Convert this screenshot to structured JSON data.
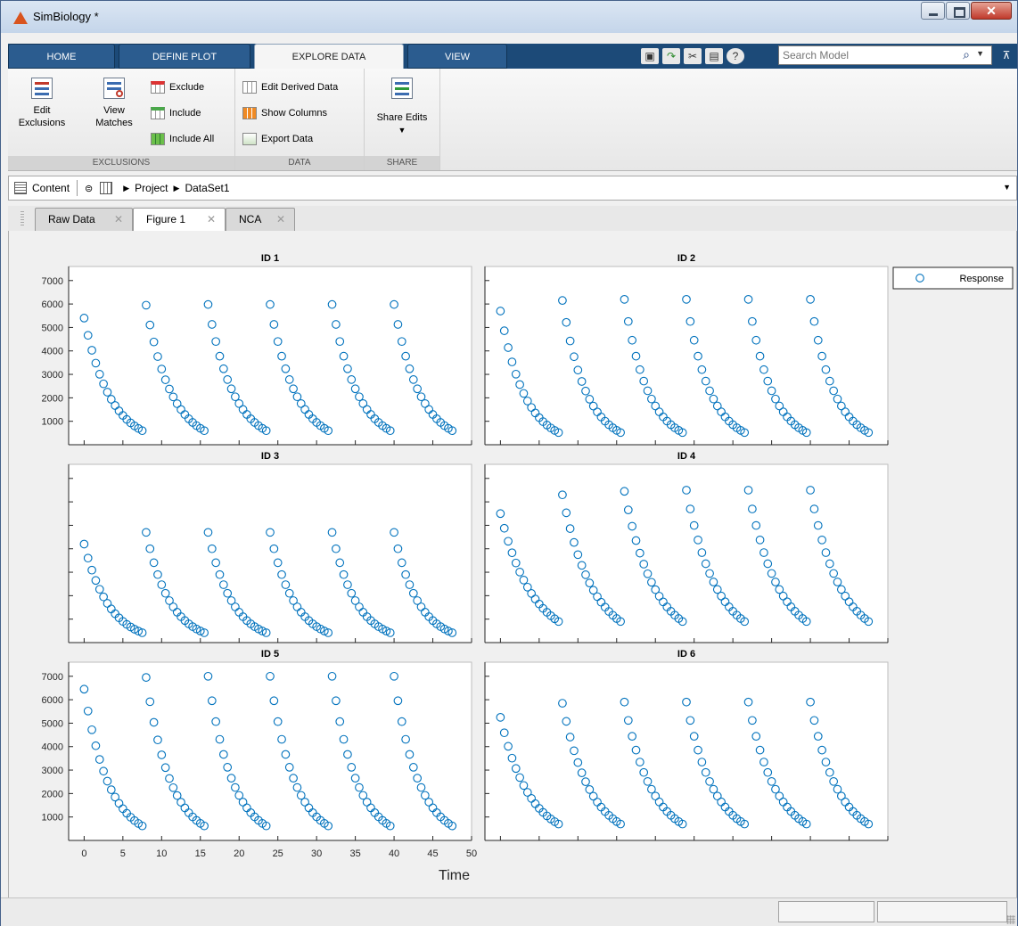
{
  "window": {
    "title": "SimBiology *",
    "controls": [
      "minimize-icon",
      "maximize-icon",
      "close-icon"
    ]
  },
  "ribbon_tabs": [
    {
      "label": "HOME",
      "active": false
    },
    {
      "label": "DEFINE PLOT",
      "active": false
    },
    {
      "label": "EXPLORE DATA",
      "active": true
    },
    {
      "label": "VIEW",
      "active": false
    }
  ],
  "search": {
    "placeholder": "Search Model"
  },
  "ribbon": {
    "exclusions": {
      "label": "EXCLUSIONS",
      "edit_exclusions": [
        "Edit",
        "Exclusions"
      ],
      "view_matches": [
        "View",
        "Matches"
      ],
      "exclude": "Exclude",
      "include": "Include",
      "include_all": "Include All"
    },
    "data": {
      "label": "DATA",
      "edit_derived": "Edit Derived Data",
      "show_columns": "Show Columns",
      "export_data": "Export Data"
    },
    "share": {
      "label": "SHARE",
      "share_edits": "Share Edits"
    }
  },
  "address": {
    "content_label": "Content",
    "crumbs": [
      "Project",
      "DataSet1"
    ]
  },
  "doc_tabs": [
    {
      "label": "Raw Data",
      "active": false
    },
    {
      "label": "Figure 1",
      "active": true
    },
    {
      "label": "NCA",
      "active": false
    }
  ],
  "chart_data": {
    "type": "scatter",
    "xlabel": "Time",
    "ylabel": "",
    "xlim": [
      -2,
      50
    ],
    "ylim": [
      0,
      7600
    ],
    "xticks": [
      0,
      5,
      10,
      15,
      20,
      25,
      30,
      35,
      40,
      45,
      50
    ],
    "yticks": [
      1000,
      2000,
      3000,
      4000,
      5000,
      6000,
      7000
    ],
    "legend": {
      "entries": [
        "Response"
      ],
      "position": "right"
    },
    "marker": "open-circle",
    "series_color": "#0072bd",
    "dose_times": [
      0,
      8,
      16,
      24,
      32,
      40
    ],
    "sample_offsets": [
      0,
      0.5,
      1,
      1.5,
      2,
      2.5,
      3,
      3.5,
      4,
      4.5,
      5,
      5.5,
      6,
      6.5,
      7,
      7.5
    ],
    "panels": [
      {
        "title": "ID 1",
        "peak": [
          5400,
          5950,
          5980,
          5980,
          5980,
          5980
        ],
        "trough": 600
      },
      {
        "title": "ID 2",
        "peak": [
          5700,
          6150,
          6200,
          6200,
          6200,
          6200
        ],
        "trough": 520
      },
      {
        "title": "ID 3",
        "peak": [
          4200,
          4700,
          4700,
          4700,
          4700,
          4700
        ],
        "trough": 420
      },
      {
        "title": "ID 4",
        "peak": [
          5500,
          6300,
          6450,
          6500,
          6500,
          6500
        ],
        "trough": 900
      },
      {
        "title": "ID 5",
        "peak": [
          6450,
          6950,
          7000,
          7000,
          7000,
          7000
        ],
        "trough": 620
      },
      {
        "title": "ID 6",
        "peak": [
          5250,
          5850,
          5900,
          5900,
          5900,
          5900
        ],
        "trough": 700
      }
    ]
  }
}
